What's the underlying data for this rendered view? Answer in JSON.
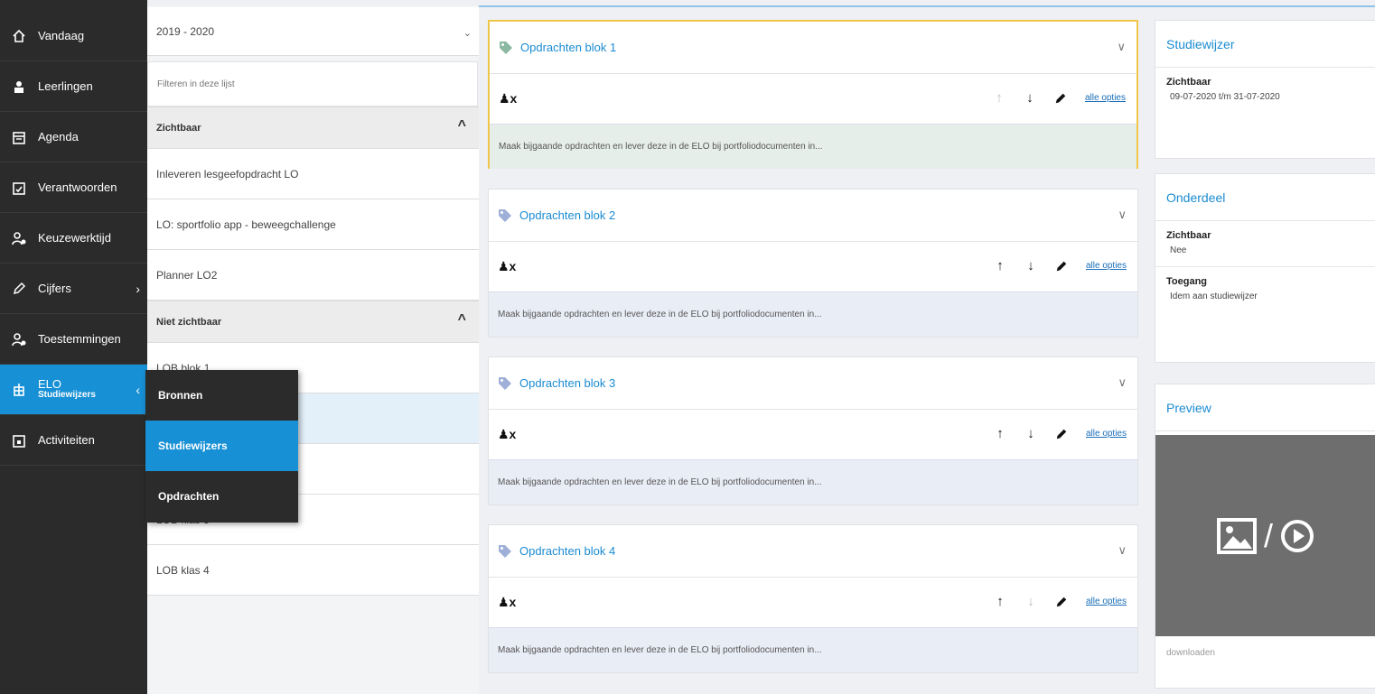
{
  "sidebar": {
    "items": [
      {
        "label": "Vandaag",
        "icon": "home-icon"
      },
      {
        "label": "Leerlingen",
        "icon": "students-icon"
      },
      {
        "label": "Agenda",
        "icon": "calendar-icon"
      },
      {
        "label": "Verantwoorden",
        "icon": "check-calendar-icon"
      },
      {
        "label": "Keuzewerktijd",
        "icon": "user-gear-icon"
      },
      {
        "label": "Cijfers",
        "icon": "pen-icon"
      },
      {
        "label": "Toestemmingen",
        "icon": "user-check-icon"
      },
      {
        "label": "ELO",
        "sublabel": "Studiewijzers",
        "icon": "elo-icon"
      },
      {
        "label": "Activiteiten",
        "icon": "activity-calendar-icon"
      }
    ]
  },
  "flyout": {
    "items": [
      "Bronnen",
      "Studiewijzers",
      "Opdrachten"
    ]
  },
  "list": {
    "year": "2019 - 2020",
    "filter_placeholder": "Filteren in deze lijst",
    "visible_header": "Zichtbaar",
    "visible_items": [
      "Inleveren lesgeefopdracht LO",
      "LO: sportfolio app - beweegchallenge",
      "Planner LO2"
    ],
    "hidden_header": "Niet zichtbaar",
    "hidden_items": [
      "LOB blok 1",
      "",
      "",
      "LOB klas 3",
      "LOB klas 4"
    ]
  },
  "cards": [
    {
      "title": "Opdrachten blok 1",
      "link": "alle opties",
      "description": "Maak bijgaande opdrachten en lever deze in de ELO bij portfoliodocumenten in..."
    },
    {
      "title": "Opdrachten blok 2",
      "link": "alle opties",
      "description": "Maak bijgaande opdrachten en lever deze in de ELO bij portfoliodocumenten in..."
    },
    {
      "title": "Opdrachten blok 3",
      "link": "alle opties",
      "description": "Maak bijgaande opdrachten en lever deze in de ELO bij portfoliodocumenten in..."
    },
    {
      "title": "Opdrachten blok 4",
      "link": "alle opties",
      "description": "Maak bijgaande opdrachten en lever deze in de ELO bij portfoliodocumenten in..."
    }
  ],
  "right": {
    "studiewijzer": {
      "title": "Studiewijzer",
      "visible_label": "Zichtbaar",
      "visible_value": "09-07-2020 t/m 31-07-2020"
    },
    "onderdeel": {
      "title": "Onderdeel",
      "visible_label": "Zichtbaar",
      "visible_value": "Nee",
      "access_label": "Toegang",
      "access_value": "Idem aan studiewijzer"
    },
    "preview": {
      "title": "Preview",
      "separator": "/",
      "download": "downloaden"
    }
  },
  "colors": {
    "accent": "#1890d5",
    "sidebar": "#2b2b2b",
    "highlight_border": "#f0c64a",
    "link": "#1a8bd2"
  }
}
